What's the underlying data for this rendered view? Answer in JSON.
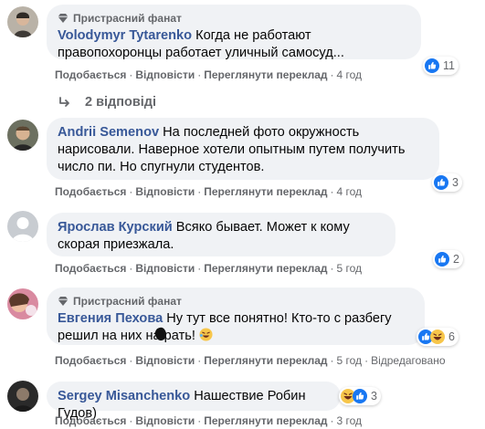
{
  "comments": [
    {
      "badge": "Пристрасний фанат",
      "author": "Volodymyr Tytarenko",
      "text": "Когда не работают правопохоронцы работает уличный самосуд...",
      "like": "Подобається",
      "reply": "Відповісти",
      "translate": "Переглянути переклад",
      "time": "4 год",
      "reactions_count": "11"
    },
    {
      "author": "Andrii Semenov",
      "text": "На последней фото окружность нарисовали. Наверное хотели опытным путем получить число пи. Но спугнули студентов.",
      "like": "Подобається",
      "reply": "Відповісти",
      "translate": "Переглянути переклад",
      "time": "4 год",
      "reactions_count": "3"
    },
    {
      "author": "Ярослав Курский",
      "text": "Всяко бывает. Может к кому скорая приезжала.",
      "like": "Подобається",
      "reply": "Відповісти",
      "translate": "Переглянути переклад",
      "time": "5 год",
      "reactions_count": "2"
    },
    {
      "badge": "Пристрасний фанат",
      "author": "Евгения Пехова",
      "text": "Ну тут все понятно! Кто-то с разбегу решил на них на     рать!",
      "like": "Подобається",
      "reply": "Відповісти",
      "translate": "Переглянути переклад",
      "time": "5 год",
      "edited": "Відредаговано",
      "reactions_count": "6"
    },
    {
      "author": "Sergey Misanchenko",
      "text": "Нашествие Робин Гудов)",
      "like": "Подобається",
      "reply": "Відповісти",
      "translate": "Переглянути переклад",
      "time": "3 год",
      "reactions_count": "3"
    }
  ],
  "replies_link": "2 відповіді",
  "icons": {
    "badge": "diamond-icon",
    "like": "like-icon",
    "haha": "haha-icon",
    "reply_arrow": "reply-arrow-icon"
  },
  "colors": {
    "author": "#385898",
    "bubble": "#f0f2f5",
    "meta": "#65676b",
    "like_blue": "#1877f2",
    "haha_yellow": "#f7c64a"
  }
}
